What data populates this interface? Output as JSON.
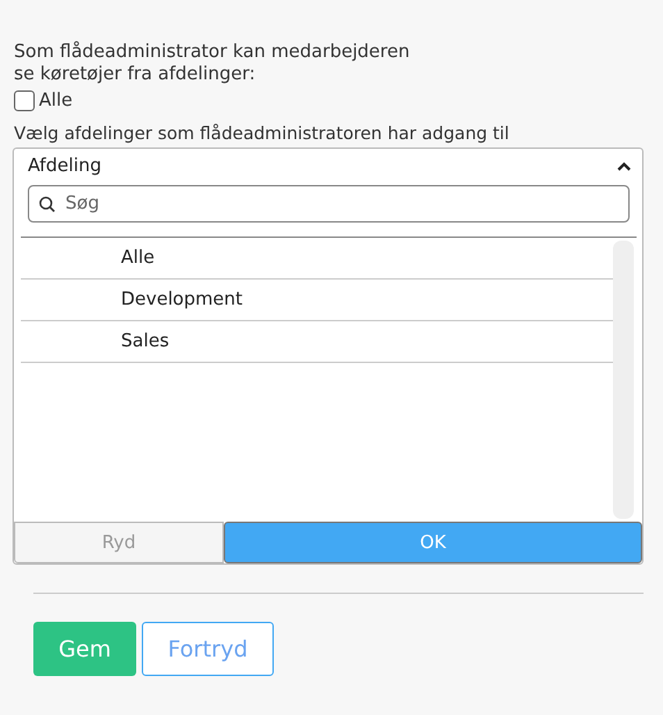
{
  "intro": "Som flådeadministrator kan medarbejderen se køretøjer fra afdelinger:",
  "all_checkbox": {
    "label": "Alle",
    "checked": false
  },
  "select_label": "Vælg afdelinger som flådeadministratoren har adgang til",
  "dropdown": {
    "title": "Afdeling",
    "expanded": true,
    "search": {
      "placeholder": "Søg"
    },
    "options": [
      {
        "label": "Alle"
      },
      {
        "label": "Development"
      },
      {
        "label": "Sales"
      }
    ],
    "clear_button": {
      "label": "Ryd",
      "disabled": true
    },
    "ok_button": {
      "label": "OK",
      "disabled": false
    }
  },
  "save_button": "Gem",
  "cancel_button": "Fortryd"
}
